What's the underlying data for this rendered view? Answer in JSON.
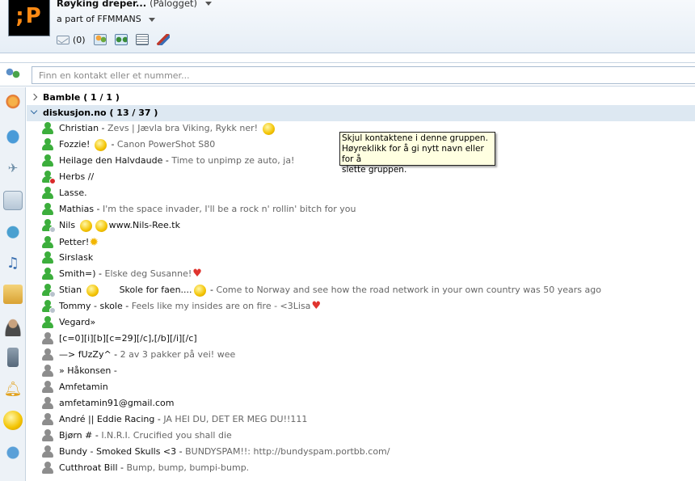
{
  "header": {
    "avatar_text": ";P",
    "user_name": "Røyking dreper...",
    "user_status": "(Pålogget)",
    "personal_message": "a part of FFMMANS",
    "mail_count": "(0)",
    "icons": [
      "mail-icon",
      "people-icon",
      "groups-icon",
      "grid-icon",
      "paintbrush-icon"
    ]
  },
  "search": {
    "placeholder": "Finn en kontakt eller et nummer..."
  },
  "sidebar": {
    "items": [
      "messenger-icon",
      "bird-icon",
      "plane-icon",
      "calendar-icon",
      "dating-icon",
      "music-icon",
      "games-icon",
      "person-icon",
      "phone-icon",
      "alert-bell-icon",
      "smiley-icon",
      "shopping-icon"
    ]
  },
  "groups": [
    {
      "label": "Bamble ( 1 / 1 )"
    },
    {
      "label": "diskusjon.no ( 13 / 37 )"
    }
  ],
  "contacts": [
    {
      "name": "Christian - ",
      "message": "Zevs | Jævla bra Viking, Rykk ner! ",
      "status": "online"
    },
    {
      "name": "Fozzie! ",
      "message": "Canon PowerShot S80",
      "name_suffix": " - ",
      "status": "online"
    },
    {
      "name": "Heilage den Halvdaude - ",
      "message": "Time to unpimp ze auto, ja!",
      "status": "online"
    },
    {
      "name": "Herbs //",
      "message": "",
      "status": "busy"
    },
    {
      "name": "Lasse.",
      "message": "",
      "status": "online"
    },
    {
      "name": "Mathias - ",
      "message": "I'm the space invader, I'll be a rock n' rollin' bitch for you",
      "status": "online"
    },
    {
      "name": "Nils ",
      "message": "",
      "name_tail": "www.Nils-Ree.tk",
      "status": "idle"
    },
    {
      "name": "Petter!",
      "message": "",
      "status": "online"
    },
    {
      "name": "Sirslask",
      "message": "",
      "status": "online"
    },
    {
      "name": "Smith=) - ",
      "message": "Elske deg Susanne!",
      "status": "online"
    },
    {
      "name": "Stian ",
      "name_tail": "Skole for faen....",
      "message": "Come to Norway and see how the road network in your own country was 50 years ago",
      "status": "idle"
    },
    {
      "name": "Tommy - skole - ",
      "message": "Feels like my insides are on fire - <3Lisa",
      "status": "idle"
    },
    {
      "name": "Vegard»",
      "message": "",
      "status": "online"
    },
    {
      "name": "[c=0][i][b][c=29][/c],[/b][/i][/c]",
      "message": "",
      "status": "offline"
    },
    {
      "name": "—> fUzZy^ - ",
      "message": "2 av 3 pakker på vei! wee",
      "status": "offline"
    },
    {
      "name": "» Håkonsen -",
      "message": "",
      "status": "offline"
    },
    {
      "name": "Amfetamin",
      "message": "",
      "status": "offline"
    },
    {
      "name": "amfetamin91@gmail.com",
      "message": "",
      "status": "offline"
    },
    {
      "name": "André || Eddie Racing - ",
      "message": "JA HEI DU, DET ER MEG DU!!111",
      "status": "offline"
    },
    {
      "name": "Bjørn # - ",
      "message": "I.N.R.I.  Crucified you shall die",
      "status": "offline"
    },
    {
      "name": "Bundy - Smoked Skulls <3 - ",
      "message": "BUNDYSPAM!!: http://bundyspam.portbb.com/",
      "status": "offline"
    },
    {
      "name": "Cutthroat Bill - ",
      "message": "Bump, bump, bumpi-bump.",
      "status": "offline"
    }
  ],
  "tooltip": {
    "text": "Skjul kontaktene i denne gruppen.\nHøyreklikk for å gi nytt navn eller for å\nslette gruppen."
  },
  "colors": {
    "online": "#3cae3c",
    "offline": "#8d8d8d",
    "busy_badge": "#d92a2a",
    "group_highlight": "#dde8f2",
    "tooltip_bg": "#ffffe1"
  }
}
